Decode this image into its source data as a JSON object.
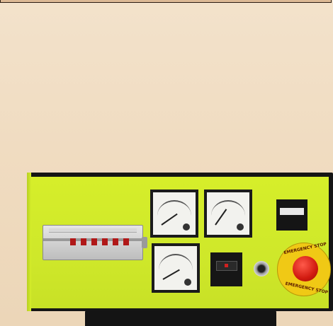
{
  "image": {
    "subject": "",
    "emergency_stop": {
      "top_label": "EMERGENCY STOP",
      "bottom_label": "EMERGENCY STOP",
      "button_color": "#d11a10",
      "ring_color": "#f0c915"
    },
    "counter_reading": "",
    "panel_color": "#d6ee2a",
    "background_color": "#f0dcc1"
  }
}
